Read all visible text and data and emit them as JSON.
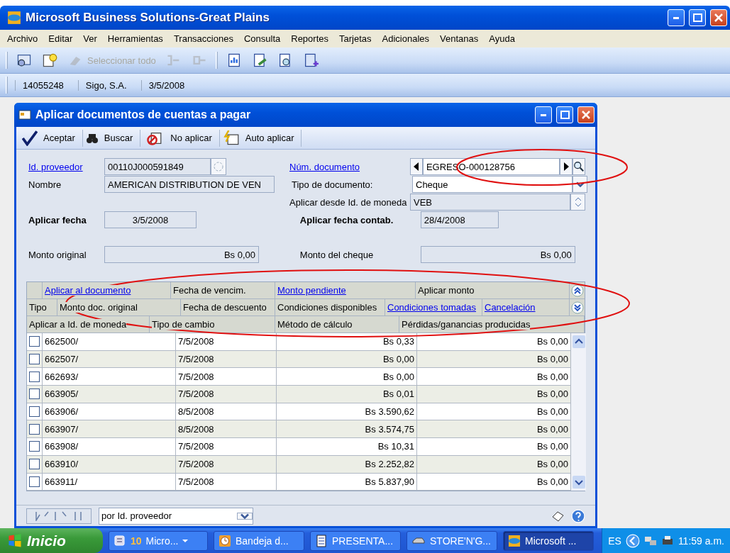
{
  "window": {
    "title": "Microsoft Business Solutions-Great Plains"
  },
  "menu": [
    "Archivo",
    "Editar",
    "Ver",
    "Herramientas",
    "Transacciones",
    "Consulta",
    "Reportes",
    "Tarjetas",
    "Adicionales",
    "Ventanas",
    "Ayuda"
  ],
  "toolbar": [
    {
      "kind": "lookup",
      "disabled": false
    },
    {
      "kind": "note",
      "disabled": false
    },
    {
      "kind": "eraser",
      "disabled": true,
      "label": "Seleccionar todo"
    },
    {
      "kind": "move-in",
      "disabled": true
    },
    {
      "kind": "move-out",
      "disabled": true
    },
    {
      "kind": "separator"
    },
    {
      "kind": "report",
      "disabled": false
    },
    {
      "kind": "edit-doc",
      "disabled": false
    },
    {
      "kind": "inspect",
      "disabled": false
    },
    {
      "kind": "add-doc",
      "disabled": false
    }
  ],
  "context_bar": [
    "14055248",
    "Sigo, S.A.",
    "3/5/2008"
  ],
  "dialog": {
    "title": "Aplicar documentos de cuentas a pagar",
    "toolbar": [
      {
        "kind": "check",
        "label": "Aceptar"
      },
      {
        "kind": "binoculars",
        "label": "Buscar"
      },
      {
        "kind": "unapply",
        "label": "No aplicar"
      },
      {
        "kind": "auto",
        "label": "Auto aplicar"
      }
    ],
    "form_rows": [
      {
        "left": {
          "label": "Id. proveedor",
          "link": true,
          "bold": false,
          "value": "00110J000591849",
          "kind": "lookup"
        },
        "right": {
          "label": "Núm. documento",
          "link": true,
          "bold": false,
          "value": "EGRESO-000128756",
          "kind": "browse"
        }
      },
      {
        "left": {
          "label": "Nombre",
          "link": false,
          "bold": false,
          "value": "AMERICAN DISTRIBUTION DE VEN",
          "kind": "text"
        },
        "right": {
          "label": "Tipo de documento:",
          "link": false,
          "bold": false,
          "value": "Cheque",
          "kind": "dropdown"
        }
      },
      {
        "right": {
          "label": "Aplicar desde Id. de moneda",
          "link": false,
          "bold": false,
          "value": "VEB",
          "kind": "spinner"
        }
      },
      {
        "left": {
          "label": "Aplicar fecha",
          "link": false,
          "bold": true,
          "value": "3/5/2008",
          "kind": "date"
        },
        "right": {
          "label": "Aplicar fecha contab.",
          "link": false,
          "bold": true,
          "value": "28/4/2008",
          "kind": "text"
        }
      },
      {
        "left": {
          "label": "Monto original",
          "link": false,
          "bold": false,
          "value": "Bs 0,00",
          "kind": "amount"
        },
        "right": {
          "label": "Monto del cheque",
          "link": false,
          "bold": false,
          "value": "Bs 0,00",
          "kind": "amount"
        }
      }
    ],
    "grid": {
      "header_rows": [
        {
          "cells": [
            {
              "label": "Aplicar al documento",
              "link": true
            },
            {
              "label": "Fecha de vencim.",
              "link": false
            },
            {
              "label": "Monto pendiente",
              "link": true
            },
            {
              "label": "Aplicar monto",
              "link": false
            }
          ],
          "kind": "expand"
        },
        {
          "cells": [
            {
              "label": "Tipo",
              "link": false
            },
            {
              "label": "Monto doc. original",
              "link": false
            },
            {
              "label": "Fecha de descuento",
              "link": false
            },
            {
              "label": "Condiciones disponibles",
              "link": false
            },
            {
              "label": "Condiciones tomadas",
              "link": true
            },
            {
              "label": "Cancelación",
              "link": true
            }
          ],
          "kind": "collapse"
        },
        {
          "cells": [
            {
              "label": "Aplicar a Id. de moneda",
              "link": false
            },
            {
              "label": "Tipo de cambio",
              "link": false
            },
            {
              "label": "Método de cálculo",
              "link": false
            },
            {
              "label": "Pérdidas/ganancias producidas",
              "link": false
            }
          ]
        }
      ],
      "rows": [
        {
          "checked": false,
          "document": "662500/",
          "due": "7/5/2008",
          "pending": "Bs 0,33",
          "apply": "Bs 0,00"
        },
        {
          "checked": false,
          "document": "662507/",
          "due": "7/5/2008",
          "pending": "Bs 0,00",
          "apply": "Bs 0,00"
        },
        {
          "checked": false,
          "document": "662693/",
          "due": "7/5/2008",
          "pending": "Bs 0,00",
          "apply": "Bs 0,00"
        },
        {
          "checked": false,
          "document": "663905/",
          "due": "7/5/2008",
          "pending": "Bs 0,01",
          "apply": "Bs 0,00"
        },
        {
          "checked": false,
          "document": "663906/",
          "due": "8/5/2008",
          "pending": "Bs 3.590,62",
          "apply": "Bs 0,00"
        },
        {
          "checked": false,
          "document": "663907/",
          "due": "8/5/2008",
          "pending": "Bs 3.574,75",
          "apply": "Bs 0,00"
        },
        {
          "checked": false,
          "document": "663908/",
          "due": "7/5/2008",
          "pending": "Bs 10,31",
          "apply": "Bs 0,00"
        },
        {
          "checked": false,
          "document": "663910/",
          "due": "7/5/2008",
          "pending": "Bs 2.252,82",
          "apply": "Bs 0,00"
        },
        {
          "checked": false,
          "document": "663911/",
          "due": "7/5/2008",
          "pending": "Bs 5.837,90",
          "apply": "Bs 0,00"
        }
      ]
    },
    "footer": {
      "sort": "por Id. proveedor"
    }
  },
  "taskbar": {
    "start": "Inicio",
    "buttons": [
      {
        "kind": "group",
        "count": "10",
        "label": "Micro...",
        "selected": false
      },
      {
        "kind": "clock",
        "label": "Bandeja d...",
        "selected": false
      },
      {
        "kind": "word",
        "label": "PRESENTA...",
        "selected": false
      },
      {
        "kind": "drive",
        "label": "STORE'N'G...",
        "selected": false
      },
      {
        "kind": "app",
        "label": "Microsoft ...",
        "selected": true
      }
    ],
    "language": "ES",
    "time": "11:59 a.m."
  }
}
